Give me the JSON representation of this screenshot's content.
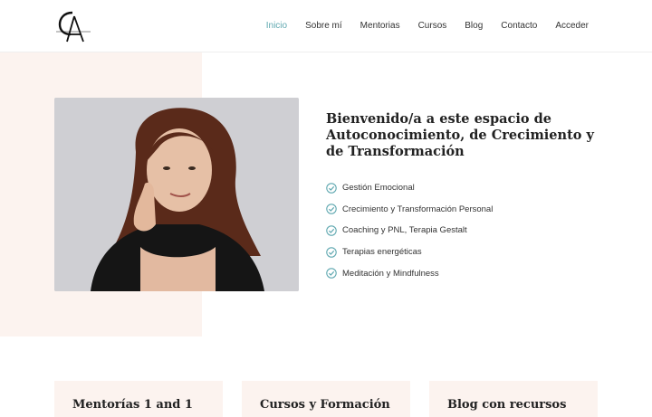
{
  "brand": {
    "logo_monogram": "CA",
    "logo_text": "CRISTINA ALVAREZ"
  },
  "nav": {
    "items": [
      {
        "label": "Inicio",
        "active": true
      },
      {
        "label": "Sobre mí",
        "active": false
      },
      {
        "label": "Mentorias",
        "active": false
      },
      {
        "label": "Cursos",
        "active": false
      },
      {
        "label": "Blog",
        "active": false
      },
      {
        "label": "Contacto",
        "active": false
      },
      {
        "label": "Acceder",
        "active": false
      }
    ]
  },
  "hero": {
    "title": "Bienvenido/a a este espacio de Autoconocimiento, de Crecimiento y de Transformación",
    "features": [
      "Gestión Emocional",
      "Crecimiento y Transformación Personal",
      "Coaching y PNL, Terapia Gestalt",
      "Terapias energéticas",
      "Meditación y Mindfulness"
    ]
  },
  "cards": [
    {
      "title": "Mentorías 1 and 1"
    },
    {
      "title": "Cursos y Formación"
    },
    {
      "title": "Blog con recursos"
    }
  ],
  "colors": {
    "accent": "#5fa8b0",
    "soft_background": "#fcf3ef",
    "heading": "#222222"
  }
}
